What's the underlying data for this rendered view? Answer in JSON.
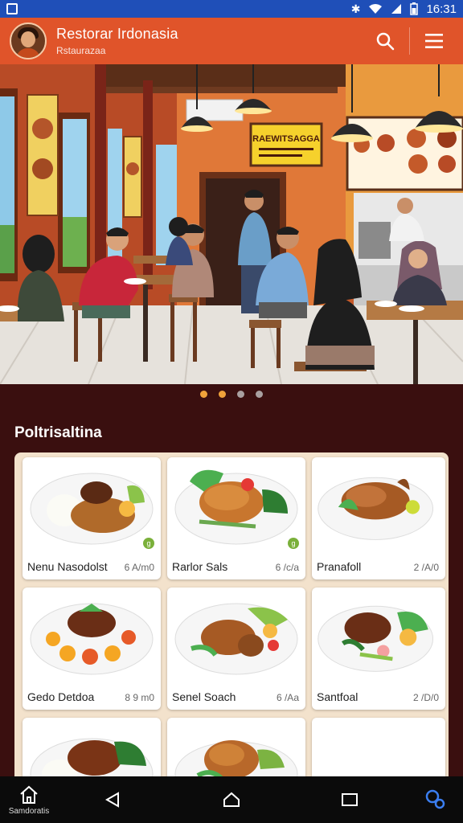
{
  "status_bar": {
    "time": "16:31",
    "icons": [
      "app-notification-icon",
      "bluetooth-icon",
      "wifi-icon",
      "signal-icon",
      "battery-icon"
    ]
  },
  "app_bar": {
    "title": "Restorar Irdonasia",
    "subtitle": "Rstaurazaa",
    "icons": [
      "search-icon",
      "menu-icon"
    ],
    "color": "#e0542a"
  },
  "hero": {
    "sign_text": "RAEWITSAGGA",
    "slides": 4,
    "active_slide": 2
  },
  "section": {
    "title": "Poltrisaltina"
  },
  "menu_items": [
    {
      "name": "Nenu Nasodolst",
      "price": "6 A/m0",
      "badge": "g"
    },
    {
      "name": "Rarlor Sals",
      "price": "6 /c/a",
      "badge": "g"
    },
    {
      "name": "Pranafoll",
      "price": "2 /A/0"
    },
    {
      "name": "Gedo Detdoa",
      "price": "8 9 m0"
    },
    {
      "name": "Senel Soach",
      "price": "6 /Aa"
    },
    {
      "name": "Santfoal",
      "price": "2 /D/0"
    },
    {
      "name": "",
      "price": ""
    },
    {
      "name": "",
      "price": ""
    },
    {
      "name": "",
      "price": ""
    }
  ],
  "nav_bar": {
    "home_label": "Samdoratis",
    "icons": [
      "home-icon",
      "back-icon",
      "circle-home-icon",
      "recents-icon",
      "settings-link-icon"
    ]
  },
  "colors": {
    "background": "#3a0f0f",
    "status_bar": "#1f4fb8",
    "active_dot": "#f0a23a",
    "panel": "#f3e2cc"
  }
}
